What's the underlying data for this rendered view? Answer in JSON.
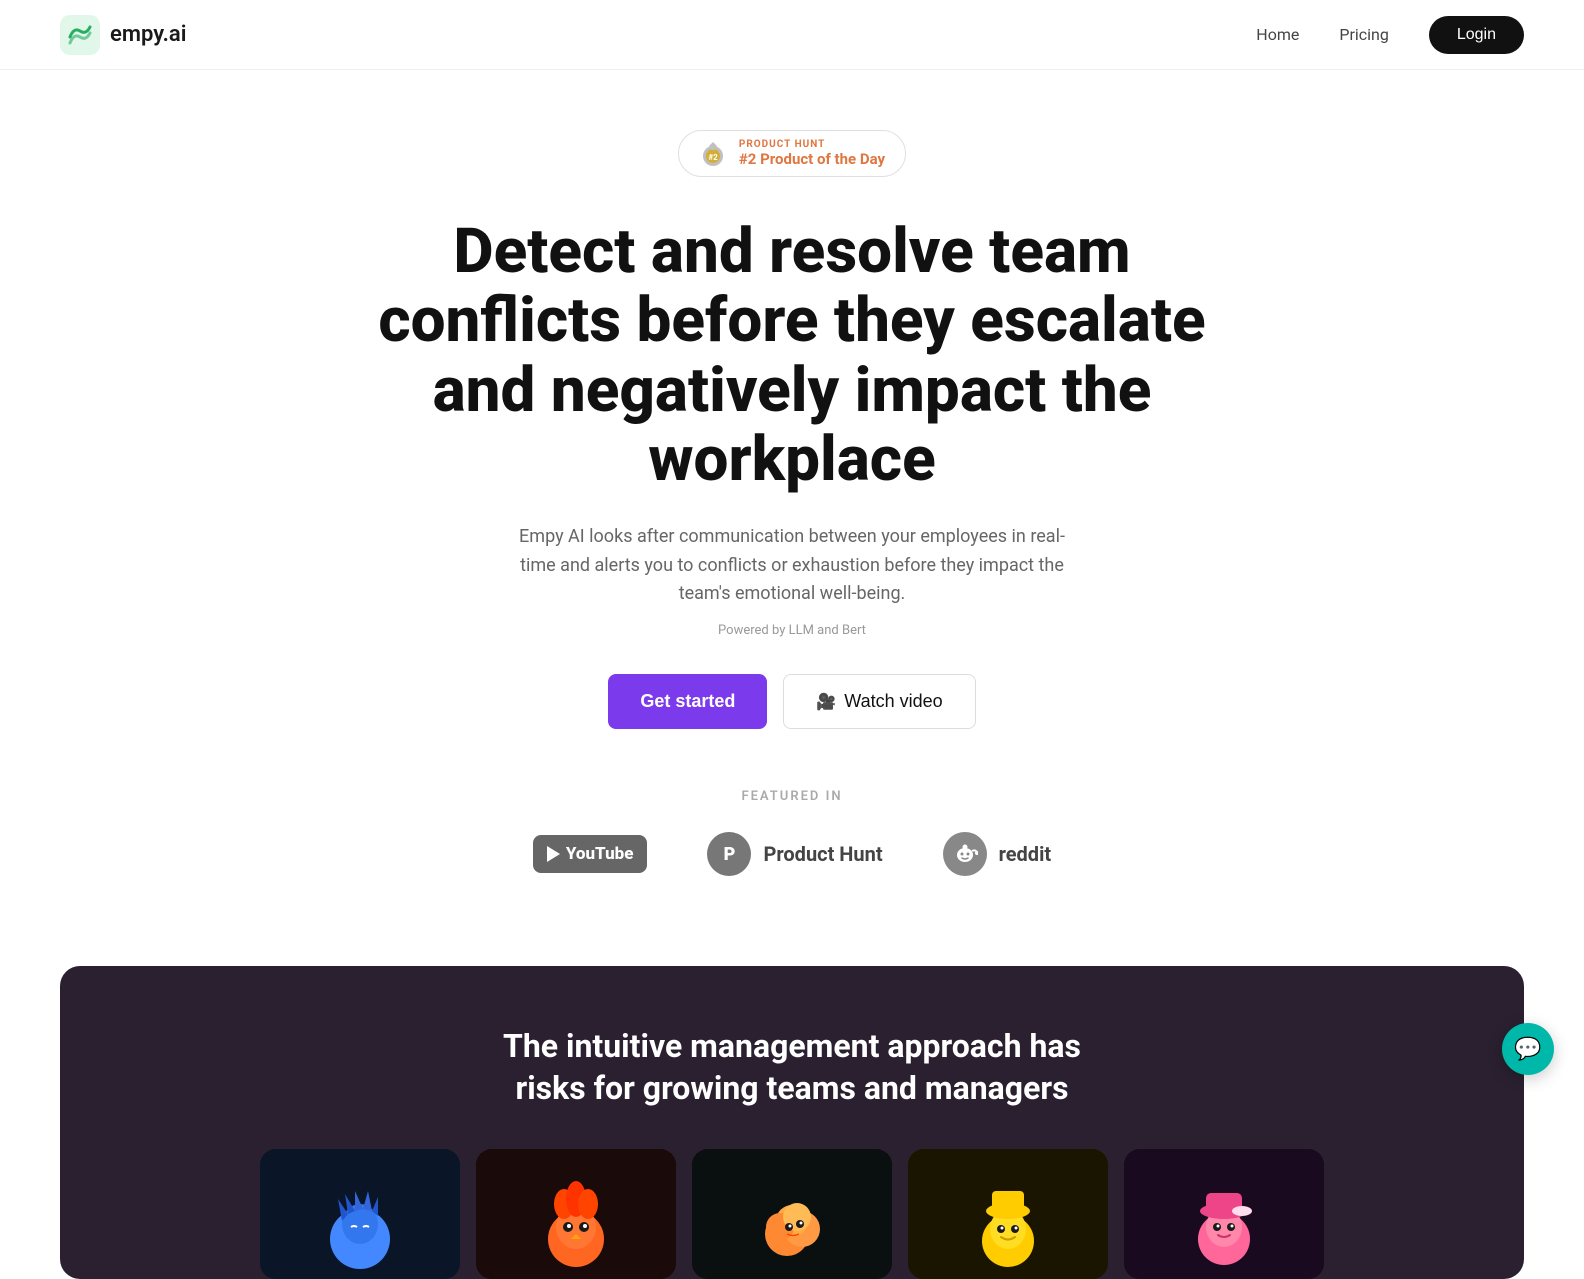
{
  "nav": {
    "logo_text": "empy.ai",
    "home_label": "Home",
    "pricing_label": "Pricing",
    "login_label": "Login"
  },
  "product_hunt_badge": {
    "label": "PRODUCT HUNT",
    "title": "#2 Product of the Day"
  },
  "hero": {
    "heading": "Detect and resolve team conflicts before they escalate and negatively impact the workplace",
    "subtext": "Empy AI looks after communication between your employees in real-time and alerts you to conflicts or exhaustion before they impact the team's emotional well-being.",
    "powered_by": "Powered by LLM and Bert",
    "get_started_label": "Get started",
    "watch_video_label": "Watch video"
  },
  "featured_in": {
    "label": "FEATURED IN",
    "logos": [
      {
        "name": "YouTube",
        "icon_type": "youtube"
      },
      {
        "name": "Product Hunt",
        "icon_type": "producthunt",
        "icon_letter": "P"
      },
      {
        "name": "reddit",
        "icon_type": "reddit"
      }
    ]
  },
  "dark_section": {
    "heading": "The intuitive management approach has risks for growing teams and managers",
    "characters": [
      {
        "id": "char-1",
        "theme": "blue"
      },
      {
        "id": "char-2",
        "theme": "orange"
      },
      {
        "id": "char-3",
        "theme": "green"
      },
      {
        "id": "char-4",
        "theme": "yellow"
      },
      {
        "id": "char-5",
        "theme": "pink"
      }
    ]
  },
  "chat": {
    "icon": "💬"
  }
}
